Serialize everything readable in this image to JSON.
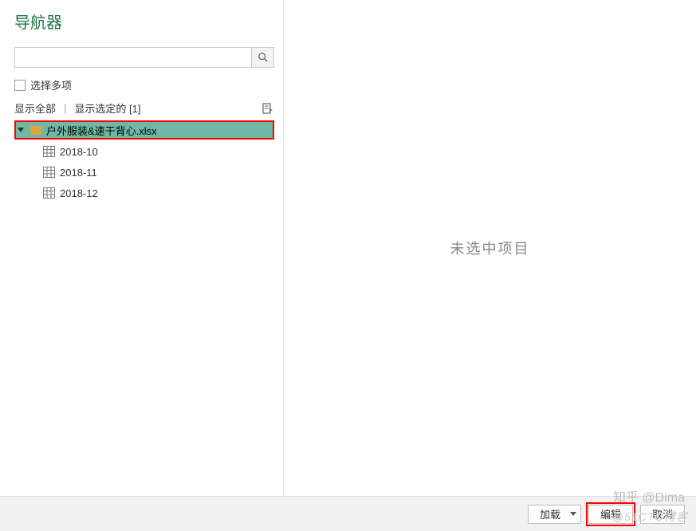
{
  "title": "导航器",
  "search": {
    "placeholder": ""
  },
  "multi_select": {
    "label": "选择多项",
    "checked": false
  },
  "filter": {
    "show_all": "显示全部",
    "show_selected": "显示选定的 [1]"
  },
  "tree": {
    "file": {
      "name": "户外服装&速干背心.xlsx"
    },
    "sheets": [
      {
        "name": "2018-10"
      },
      {
        "name": "2018-11"
      },
      {
        "name": "2018-12"
      }
    ]
  },
  "preview": {
    "empty_text": "未选中项目"
  },
  "footer": {
    "load": "加载",
    "edit": "编辑",
    "cancel": "取消"
  },
  "watermark": "知乎 @Dima",
  "watermark2": "@51CTO博客",
  "colors": {
    "accent": "#217346",
    "highlight": "#ff0000",
    "selection": "#6fb9a2"
  }
}
